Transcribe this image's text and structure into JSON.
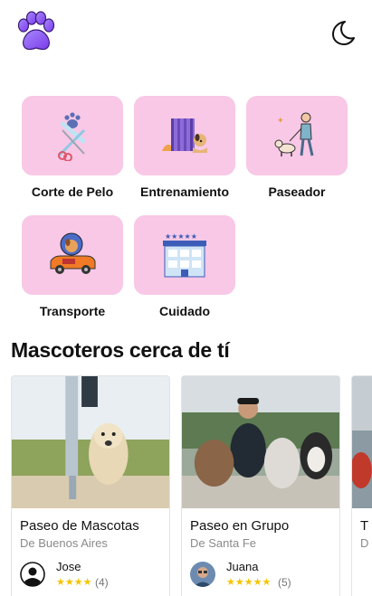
{
  "header": {
    "logo_icon": "paw-icon",
    "theme_icon": "moon-icon",
    "accent": "#8b5cf6"
  },
  "services": [
    {
      "label": "Corte de Pelo",
      "icon": "grooming-icon"
    },
    {
      "label": "Entrenamiento",
      "icon": "training-icon"
    },
    {
      "label": "Paseador",
      "icon": "dog-walker-icon"
    },
    {
      "label": "Transporte",
      "icon": "transport-icon"
    },
    {
      "label": "Cuidado",
      "icon": "hotel-icon"
    }
  ],
  "tile_color": "#f8c8e6",
  "section": {
    "title": "Mascoteros cerca de tí"
  },
  "cards": [
    {
      "title": "Paseo de Mascotas",
      "location": "De Buenos Aires",
      "owner": "Jose",
      "stars": "★★★★",
      "reviews": "(4)"
    },
    {
      "title": "Paseo en Grupo",
      "location": "De Santa Fe",
      "owner": "Juana",
      "stars": "★★★★★",
      "reviews": "(5)"
    },
    {
      "title": "T",
      "location": "D"
    }
  ],
  "star_color": "#f6c400"
}
